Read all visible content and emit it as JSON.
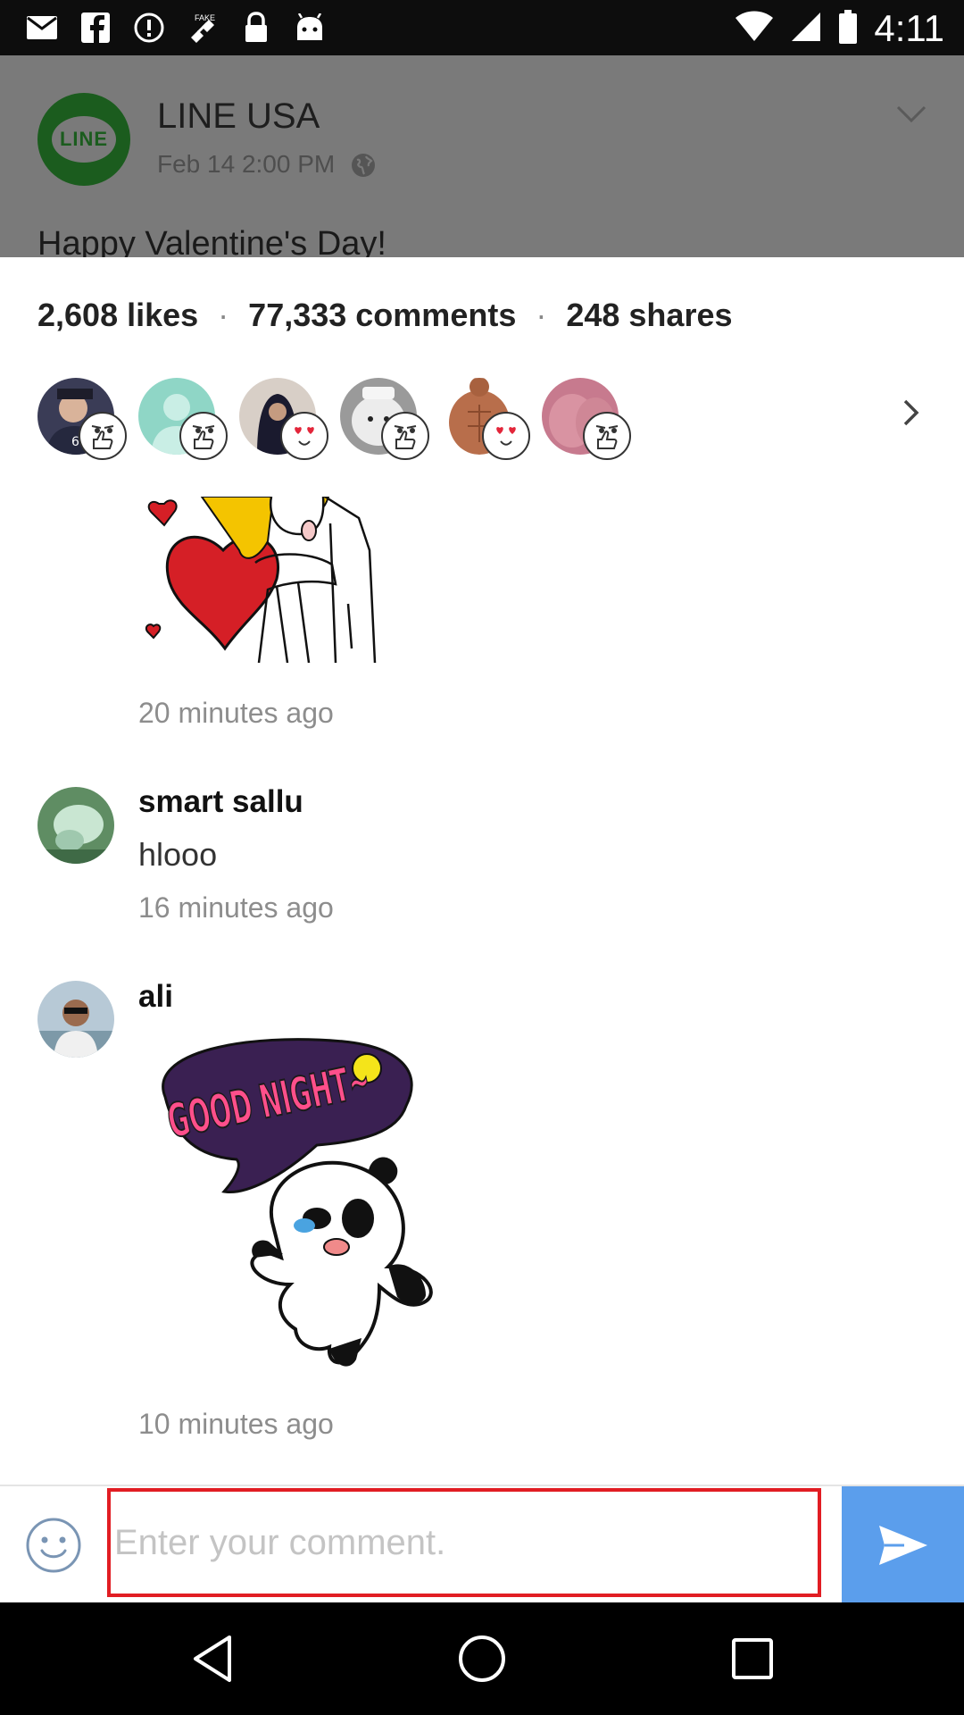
{
  "status_bar": {
    "time": "4:11",
    "icons": [
      "mail-icon",
      "facebook-icon",
      "alert-icon",
      "fake-gps-icon",
      "lock-icon",
      "android-icon",
      "wifi-icon",
      "signal-icon",
      "battery-icon"
    ]
  },
  "post": {
    "logo_text": "LINE",
    "name": "LINE USA",
    "date": "Feb 14 2:00 PM",
    "text": "Happy Valentine's Day!"
  },
  "stats": {
    "likes": "2,608 likes",
    "comments": "77,333 comments",
    "shares": "248 shares",
    "separator": "·"
  },
  "reactions": [
    "thumbs-up",
    "thumbs-up",
    "heart-eyes",
    "thumbs-up",
    "heart-eyes",
    "thumbs-up"
  ],
  "comments": [
    {
      "time": "20 minutes ago",
      "sticker": "valentine-kiss-sticker"
    },
    {
      "name": "smart sallu",
      "text": "hlooo",
      "time": "16 minutes ago"
    },
    {
      "name": "ali",
      "sticker": "good-night-panda-sticker",
      "sticker_text": "GOOD NIGHT~",
      "time": "10 minutes ago"
    }
  ],
  "input": {
    "placeholder": "Enter your comment."
  },
  "colors": {
    "send_button": "#5b9eec",
    "input_border": "#e11d23",
    "line_green": "#1b5c1e"
  }
}
